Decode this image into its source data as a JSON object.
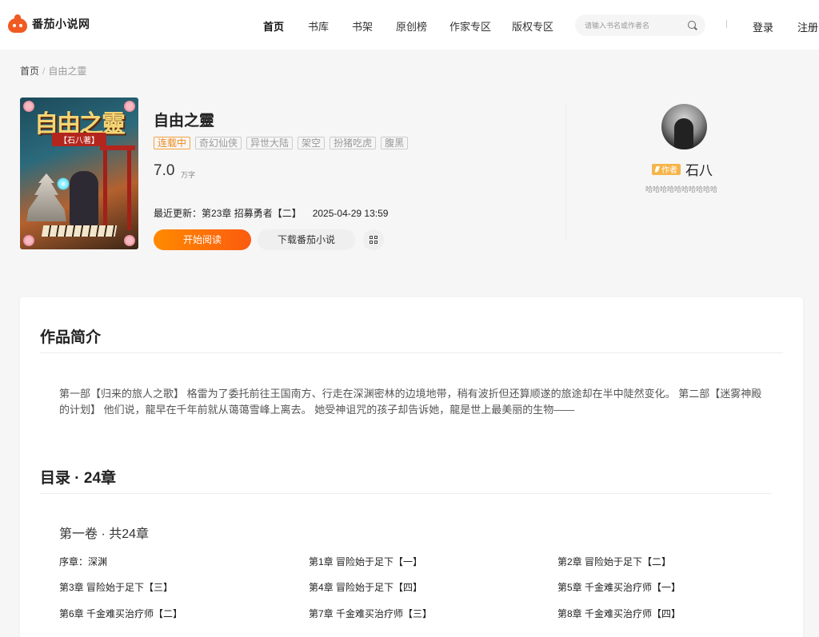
{
  "header": {
    "logo_text": "番茄小说网",
    "nav": [
      "首页",
      "书库",
      "书架",
      "原创榜",
      "作家专区",
      "版权专区"
    ],
    "search_placeholder": "请输入书名或作者名",
    "login": "登录",
    "register": "注册"
  },
  "breadcrumb": {
    "home": "首页",
    "separator": "/",
    "current": "自由之靈"
  },
  "book": {
    "cover_title": "自由之靈",
    "cover_author": "【石八著】",
    "title": "自由之靈",
    "status": "连载中",
    "tags": [
      "奇幻仙侠",
      "异世大陆",
      "架空",
      "扮猪吃虎",
      "腹黑"
    ],
    "word_count": "7.0",
    "word_unit": "万字",
    "latest_label": "最近更新：",
    "latest_chapter": "第23章 招募勇者【二】",
    "latest_date": "2025-04-29 13:59",
    "read_button": "开始阅读",
    "download_button": "下载番茄小说"
  },
  "author": {
    "badge": "作者",
    "name": "石八",
    "bio": "哈哈哈哈哈哈哈哈哈哈"
  },
  "intro": {
    "title": "作品简介",
    "text": "第一部【归来的旅人之歌】 格雷为了委托前往王国南方、行走在深渊密林的边境地带，稍有波折但还算顺遂的旅途却在半中陡然变化。 第二部【迷雾神殿的计划】 他们说，龍早在千年前就从蔼蔼雪峰上离去。 她受神诅咒的孩子却告诉她，龍是世上最美丽的生物——"
  },
  "catalog": {
    "title": "目录 · 24章",
    "volume": "第一卷 · 共24章",
    "chapters": [
      "序章：深渊",
      "第1章 冒险始于足下【一】",
      "第2章 冒险始于足下【二】",
      "第3章 冒险始于足下【三】",
      "第4章 冒险始于足下【四】",
      "第5章 千金难买治疗师【一】",
      "第6章 千金难买治疗师【二】",
      "第7章 千金难买治疗师【三】",
      "第8章 千金难买治疗师【四】"
    ]
  },
  "colors": {
    "brand": "#f05a22",
    "read_button": "#fb5b0f",
    "status": "#f08a1c",
    "author_badge": "#f6b54a"
  }
}
